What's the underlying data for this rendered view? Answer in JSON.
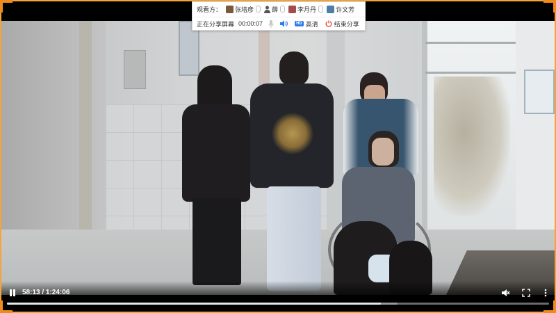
{
  "share_toolbar": {
    "viewers_label": "观看方：",
    "viewers": [
      {
        "name": "张培彦",
        "avatar_color": "#7b5a3c"
      },
      {
        "name": "薛",
        "avatar_color": "#4a4a4a"
      },
      {
        "name": "李月丹",
        "avatar_color": "#a44b4b"
      },
      {
        "name": "许文芳",
        "avatar_color": "#4d7ea8"
      }
    ],
    "status": "正在分享屏幕",
    "timer": "00:00:07",
    "hd_badge": "HD",
    "hd_label": "高清",
    "end_label": "结束分享",
    "end_color": "#e0463a"
  },
  "player": {
    "time": "58:13 / 1:24:06",
    "progress": 0.69,
    "buffered": 0.72
  },
  "icons": [
    "pause-icon",
    "mute-icon",
    "fullscreen-icon",
    "more-icon",
    "microphone-icon",
    "speaker-icon",
    "power-icon"
  ],
  "accent_frame_color": "#f4a43a"
}
